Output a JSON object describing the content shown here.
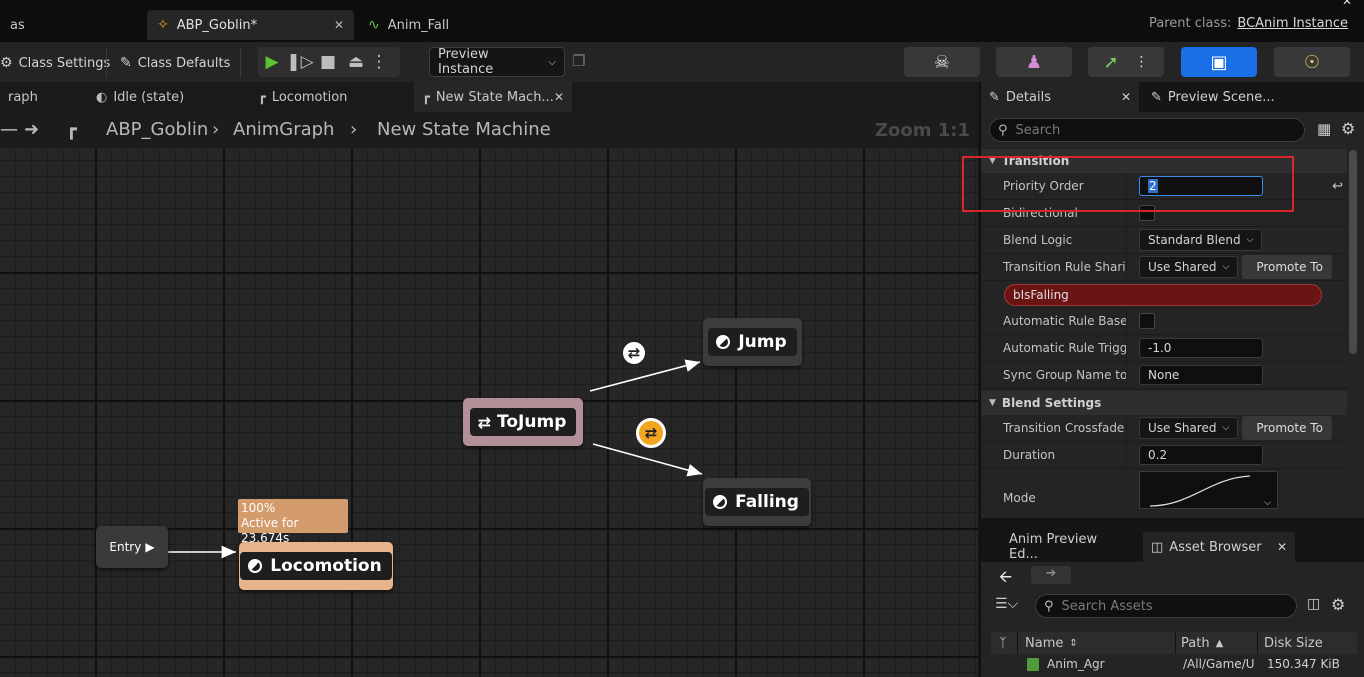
{
  "top_tabs": [
    {
      "label": "as"
    },
    {
      "label": "ABP_Goblin*"
    },
    {
      "label": "Anim_Fall"
    }
  ],
  "parent_class": {
    "label": "Parent class:",
    "value": "BCAnim Instance"
  },
  "toolbar": {
    "class_settings": "Class Settings",
    "class_defaults": "Class Defaults",
    "preview_instance": "Preview Instance"
  },
  "graph_tabs": [
    {
      "label": "raph"
    },
    {
      "label": "Idle (state)"
    },
    {
      "label": "Locomotion"
    },
    {
      "label": "New State Mach..."
    }
  ],
  "breadcrumb": {
    "items": [
      "ABP_Goblin",
      "AnimGraph",
      "New State Machine"
    ],
    "zoom": "Zoom 1:1"
  },
  "graph": {
    "nodes": {
      "entry": "Entry",
      "locomotion": "Locomotion",
      "to_jump": "ToJump",
      "jump": "Jump",
      "falling": "Falling"
    },
    "tooltip": {
      "percent": "100%",
      "active": "Active for 23.674s"
    }
  },
  "details": {
    "tabs": [
      "Details",
      "Preview Scene..."
    ],
    "search_placeholder": "Search",
    "category_transition": "Transition",
    "priority_order_label": "Priority Order",
    "priority_order_value": "2",
    "bidirectional_label": "Bidirectional",
    "blend_logic_label": "Blend Logic",
    "blend_logic_value": "Standard Blend",
    "rule_sharing_label": "Transition Rule Sharing",
    "rule_sharing_value": "Use Shared",
    "promote_label": "Promote To",
    "shared_rule_name": "bIsFalling",
    "auto_rule_label": "Automatic Rule Based...",
    "auto_trigger_label": "Automatic Rule Trigge...",
    "auto_trigger_value": "-1.0",
    "sync_group_label": "Sync Group Name to R...",
    "sync_group_value": "None",
    "category_blend": "Blend Settings",
    "crossfade_label": "Transition Crossfade Sha",
    "crossfade_value": "Use Shared",
    "promote_label_2": "Promote To",
    "duration_label": "Duration",
    "duration_value": "0.2",
    "mode_label": "Mode"
  },
  "assets": {
    "tabs": [
      "Anim Preview Ed...",
      "Asset Browser"
    ],
    "search_placeholder": "Search Assets",
    "columns": [
      "Name",
      "Path",
      "Disk Size"
    ],
    "rows": [
      {
        "name": "Anim_Agr",
        "path": "/All/Game/U",
        "size": "150.347 KiB"
      }
    ]
  },
  "colors": {
    "accent_blue": "#1a6ee6",
    "play_green": "#5bc236",
    "highlight_red": "#d8262b",
    "active_state": "#e8b48c",
    "transition_node": "#b38f97",
    "shared_rule_bg": "#6a1414"
  }
}
